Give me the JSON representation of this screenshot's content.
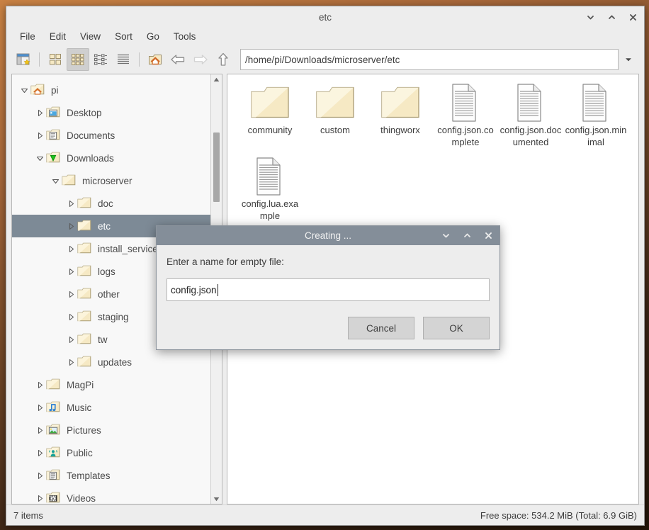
{
  "window": {
    "title": "etc",
    "controls": [
      {
        "name": "minimize-button",
        "icon": "chevron-down-icon"
      },
      {
        "name": "maximize-button",
        "icon": "chevron-up-icon"
      },
      {
        "name": "close-button",
        "icon": "close-icon"
      }
    ]
  },
  "menubar": {
    "items": [
      {
        "label": "File"
      },
      {
        "label": "Edit"
      },
      {
        "label": "View"
      },
      {
        "label": "Sort"
      },
      {
        "label": "Go"
      },
      {
        "label": "Tools"
      }
    ]
  },
  "toolbar": {
    "new_tab_icon": "new-tab-icon",
    "view_icons_icon": "view-large-icons-icon",
    "view_thumbnails_icon": "view-thumbnails-icon",
    "view_compact_icon": "view-compact-list-icon",
    "view_detail_icon": "view-detailed-list-icon",
    "home_icon": "home-folder-icon",
    "back_icon": "arrow-back-icon",
    "forward_icon": "arrow-forward-icon",
    "up_icon": "arrow-up-icon",
    "path_value": "/home/pi/Downloads/microserver/etc",
    "path_placeholder": "Path",
    "path_dropdown_icon": "chevron-down-icon"
  },
  "sidebar": {
    "items": [
      {
        "label": "pi",
        "icon": "home-folder-icon",
        "indent": 1,
        "expander": "expanded",
        "selected": false
      },
      {
        "label": "Desktop",
        "icon": "desktop-folder-icon",
        "indent": 2,
        "expander": "collapsed",
        "selected": false
      },
      {
        "label": "Documents",
        "icon": "documents-folder-icon",
        "indent": 2,
        "expander": "collapsed",
        "selected": false
      },
      {
        "label": "Downloads",
        "icon": "downloads-folder-icon",
        "indent": 2,
        "expander": "expanded",
        "selected": false
      },
      {
        "label": "microserver",
        "icon": "folder-icon",
        "indent": 3,
        "expander": "expanded",
        "selected": false
      },
      {
        "label": "doc",
        "icon": "folder-icon",
        "indent": 4,
        "expander": "collapsed",
        "selected": false
      },
      {
        "label": "etc",
        "icon": "folder-icon",
        "indent": 4,
        "expander": "collapsed",
        "selected": true
      },
      {
        "label": "install_service",
        "icon": "folder-icon",
        "indent": 4,
        "expander": "collapsed",
        "selected": false
      },
      {
        "label": "logs",
        "icon": "folder-icon",
        "indent": 4,
        "expander": "collapsed",
        "selected": false
      },
      {
        "label": "other",
        "icon": "folder-icon",
        "indent": 4,
        "expander": "collapsed",
        "selected": false
      },
      {
        "label": "staging",
        "icon": "folder-icon",
        "indent": 4,
        "expander": "collapsed",
        "selected": false
      },
      {
        "label": "tw",
        "icon": "folder-icon",
        "indent": 4,
        "expander": "collapsed",
        "selected": false
      },
      {
        "label": "updates",
        "icon": "folder-icon",
        "indent": 4,
        "expander": "collapsed",
        "selected": false
      },
      {
        "label": "MagPi",
        "icon": "folder-icon",
        "indent": 2,
        "expander": "collapsed",
        "selected": false
      },
      {
        "label": "Music",
        "icon": "music-folder-icon",
        "indent": 2,
        "expander": "collapsed",
        "selected": false
      },
      {
        "label": "Pictures",
        "icon": "pictures-folder-icon",
        "indent": 2,
        "expander": "collapsed",
        "selected": false
      },
      {
        "label": "Public",
        "icon": "public-folder-icon",
        "indent": 2,
        "expander": "collapsed",
        "selected": false
      },
      {
        "label": "Templates",
        "icon": "templates-folder-icon",
        "indent": 2,
        "expander": "collapsed",
        "selected": false
      },
      {
        "label": "Videos",
        "icon": "videos-folder-icon",
        "indent": 2,
        "expander": "collapsed",
        "selected": false
      }
    ],
    "scroll_up_icon": "triangle-up-icon",
    "scroll_down_icon": "triangle-down-icon"
  },
  "files": {
    "items": [
      {
        "name": "community",
        "type": "folder"
      },
      {
        "name": "custom",
        "type": "folder"
      },
      {
        "name": "thingworx",
        "type": "folder"
      },
      {
        "name": "config.json.complete",
        "type": "document"
      },
      {
        "name": "config.json.documented",
        "type": "document"
      },
      {
        "name": "config.json.minimal",
        "type": "document"
      },
      {
        "name": "config.lua.example",
        "type": "document"
      }
    ]
  },
  "statusbar": {
    "item_count": "7 items",
    "free_space": "Free space: 534.2 MiB (Total: 6.9 GiB)"
  },
  "dialog": {
    "title": "Creating ...",
    "prompt": "Enter a name for empty file:",
    "input_value": "config.json",
    "input_placeholder": "File name",
    "cancel_label": "Cancel",
    "ok_label": "OK",
    "controls": [
      {
        "name": "dialog-minimize-button",
        "icon": "chevron-down-icon"
      },
      {
        "name": "dialog-maximize-button",
        "icon": "chevron-up-icon"
      },
      {
        "name": "dialog-close-button",
        "icon": "close-icon"
      }
    ]
  },
  "colors": {
    "selection": "#7d8a96",
    "dialog_titlebar": "#848e99",
    "window_chrome": "#ededed",
    "folder_fill": "#f6e9c4"
  }
}
